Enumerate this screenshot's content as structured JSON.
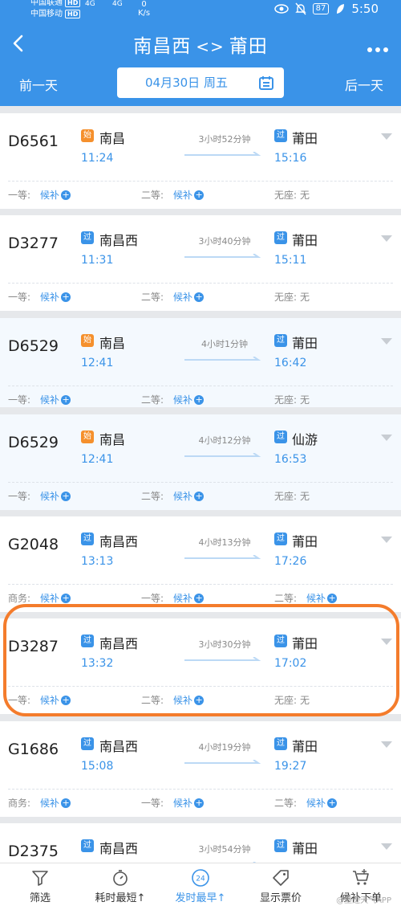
{
  "status_bar": {
    "carrier1": "中国联通",
    "carrier2": "中国移动",
    "hd": "HD",
    "sig1": "4G",
    "sig2": "4G",
    "speed_value": "0",
    "speed_unit": "K/s",
    "battery": "87",
    "time": "5:50"
  },
  "header": {
    "from": "南昌西",
    "to": "莆田",
    "prev_day": "前一天",
    "next_day": "后一天",
    "date": "04月30日 周五"
  },
  "trains": [
    {
      "no": "D6561",
      "dep_tag": "始",
      "dep_station": "南昌",
      "dep_time": "11:24",
      "duration": "3小时52分钟",
      "arr_tag": "过",
      "arr_station": "莆田",
      "arr_time": "15:16",
      "seats": [
        {
          "label": "一等:",
          "value": "候补"
        },
        {
          "label": "二等:",
          "value": "候补"
        },
        {
          "label": "无座:",
          "value": "无"
        }
      ]
    },
    {
      "no": "D3277",
      "dep_tag": "过",
      "dep_station": "南昌西",
      "dep_time": "11:31",
      "duration": "3小时40分钟",
      "arr_tag": "过",
      "arr_station": "莆田",
      "arr_time": "15:11",
      "seats": [
        {
          "label": "一等:",
          "value": "候补"
        },
        {
          "label": "二等:",
          "value": "候补"
        },
        {
          "label": "无座:",
          "value": "无"
        }
      ]
    },
    {
      "no": "D6529",
      "dep_tag": "始",
      "dep_station": "南昌",
      "dep_time": "12:41",
      "duration": "4小时1分钟",
      "arr_tag": "过",
      "arr_station": "莆田",
      "arr_time": "16:42",
      "seats": [
        {
          "label": "一等:",
          "value": "候补"
        },
        {
          "label": "二等:",
          "value": "候补"
        },
        {
          "label": "无座:",
          "value": "无"
        }
      ]
    },
    {
      "no": "D6529",
      "dep_tag": "始",
      "dep_station": "南昌",
      "dep_time": "12:41",
      "duration": "4小时12分钟",
      "arr_tag": "过",
      "arr_station": "仙游",
      "arr_time": "16:53",
      "seats": [
        {
          "label": "一等:",
          "value": "候补"
        },
        {
          "label": "二等:",
          "value": "候补"
        },
        {
          "label": "无座:",
          "value": "无"
        }
      ]
    },
    {
      "no": "G2048",
      "dep_tag": "过",
      "dep_station": "南昌西",
      "dep_time": "13:13",
      "duration": "4小时13分钟",
      "arr_tag": "过",
      "arr_station": "莆田",
      "arr_time": "17:26",
      "seats": [
        {
          "label": "商务:",
          "value": "候补"
        },
        {
          "label": "一等:",
          "value": "候补"
        },
        {
          "label": "二等:",
          "value": "候补"
        }
      ]
    },
    {
      "no": "D3287",
      "dep_tag": "过",
      "dep_station": "南昌西",
      "dep_time": "13:32",
      "duration": "3小时30分钟",
      "arr_tag": "过",
      "arr_station": "莆田",
      "arr_time": "17:02",
      "seats": [
        {
          "label": "一等:",
          "value": "候补"
        },
        {
          "label": "二等:",
          "value": "候补"
        },
        {
          "label": "无座:",
          "value": "无"
        }
      ]
    },
    {
      "no": "G1686",
      "dep_tag": "过",
      "dep_station": "南昌西",
      "dep_time": "15:08",
      "duration": "4小时19分钟",
      "arr_tag": "过",
      "arr_station": "莆田",
      "arr_time": "19:27",
      "seats": [
        {
          "label": "商务:",
          "value": "候补"
        },
        {
          "label": "一等:",
          "value": "候补"
        },
        {
          "label": "二等:",
          "value": "候补"
        }
      ]
    },
    {
      "no": "D2375",
      "dep_tag": "过",
      "dep_station": "南昌西",
      "dep_time": "",
      "duration": "3小时54分钟",
      "arr_tag": "过",
      "arr_station": "莆田",
      "arr_time": "",
      "seats": []
    }
  ],
  "bottom_bar": {
    "filter": "筛选",
    "shortest": "耗时最短↑",
    "earliest": "发时最早↑",
    "earliest_icon_text": "24",
    "show_price": "显示票价",
    "waitlist": "候补下单",
    "watermark": "@墨迹天气APP"
  },
  "colors": {
    "primary": "#3a93e8",
    "origin_badge": "#f5902d",
    "highlight": "#f47c2c"
  }
}
